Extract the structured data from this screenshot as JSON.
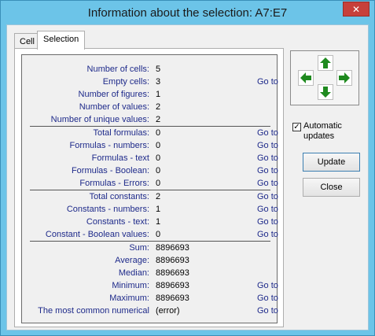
{
  "window": {
    "title": "Information about the selection: A7:E7",
    "close_glyph": "✕"
  },
  "tabs": [
    {
      "label": "Cell",
      "active": false
    },
    {
      "label": "Selection",
      "active": true
    }
  ],
  "rows": [
    {
      "label": "Number of cells:",
      "value": "5",
      "goto": ""
    },
    {
      "label": "Empty cells:",
      "value": "3",
      "goto": "Go to"
    },
    {
      "label": "Number of figures:",
      "value": "1",
      "goto": ""
    },
    {
      "label": "Number of values:",
      "value": "2",
      "goto": ""
    },
    {
      "label": "Number of unique values:",
      "value": "2",
      "goto": ""
    },
    {
      "label": "Total formulas:",
      "value": "0",
      "goto": "Go to"
    },
    {
      "label": "Formulas - numbers:",
      "value": "0",
      "goto": "Go to"
    },
    {
      "label": "Formulas - text",
      "value": "0",
      "goto": "Go to"
    },
    {
      "label": "Formulas - Boolean:",
      "value": "0",
      "goto": "Go to"
    },
    {
      "label": "Formulas - Errors:",
      "value": "0",
      "goto": "Go to"
    },
    {
      "label": "Total constants:",
      "value": "2",
      "goto": "Go to"
    },
    {
      "label": "Constants - numbers:",
      "value": "1",
      "goto": "Go to"
    },
    {
      "label": "Constants - text:",
      "value": "1",
      "goto": "Go to"
    },
    {
      "label": "Constant - Boolean values:",
      "value": "0",
      "goto": "Go to"
    },
    {
      "label": "Sum:",
      "value": "8896693",
      "goto": ""
    },
    {
      "label": "Average:",
      "value": "8896693",
      "goto": ""
    },
    {
      "label": "Median:",
      "value": "8896693",
      "goto": ""
    },
    {
      "label": "Minimum:",
      "value": "8896693",
      "goto": "Go to"
    },
    {
      "label": "Maximum:",
      "value": "8896693",
      "goto": "Go to"
    },
    {
      "label": "The most common numerical",
      "value": "(error)",
      "goto": "Go to"
    }
  ],
  "navigation": {
    "arrow_color": "#1f8a1f",
    "icons": [
      "arrow-up-icon",
      "arrow-down-icon",
      "arrow-left-icon",
      "arrow-right-icon"
    ]
  },
  "options": {
    "automatic_updates_label": "Automatic\nupdates",
    "automatic_updates_checked": true,
    "check_glyph": "✓"
  },
  "buttons": {
    "update_label": "Update",
    "close_label": "Close"
  }
}
